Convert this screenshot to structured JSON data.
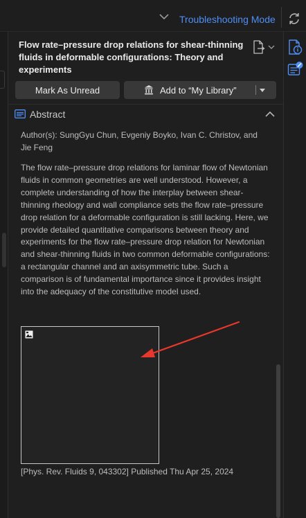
{
  "topbar": {
    "mode_label": "Troubleshooting Mode",
    "sync_icon": "sync-icon"
  },
  "item": {
    "title": "Flow rate–pressure drop relations for shear-thinning fluids in deformable configurations: Theory and experiments",
    "attachment_icon": "document-export-icon"
  },
  "buttons": {
    "mark_unread": "Mark As Unread",
    "add_to_library": "Add to “My Library”"
  },
  "abstract": {
    "heading": "Abstract",
    "authors": "Author(s): SungGyu Chun, Evgeniy Boyko, Ivan C. Christov, and Jie Feng",
    "text": "The flow rate–pressure drop relations for laminar flow of Newtonian fluids in common geometries are well understood. However, a complete understanding of how the interplay between shear-thinning rheology and wall compliance sets the flow rate–pressure drop relation for a deformable configuration is still lacking. Here, we provide detailed quantitative comparisons between theory and experiments for the flow rate–pressure drop relation for Newtonian and shear-thinning fluids in two common deformable configurations: a rectangular channel and an axisymmetric tube. Such a comparison is of fundamental importance since it provides insight into the adequacy of the constitutive model used.",
    "citation": "[Phys. Rev. Fluids 9, 043302] Published Thu Apr 25, 2024"
  },
  "side_panel": {
    "info_icon": "item-info-icon",
    "notes_icon": "notes-icon"
  },
  "colors": {
    "accent": "#4f8ff7",
    "background": "#1f1f1f",
    "button": "#383838",
    "annotation_arrow": "#e8372c"
  }
}
